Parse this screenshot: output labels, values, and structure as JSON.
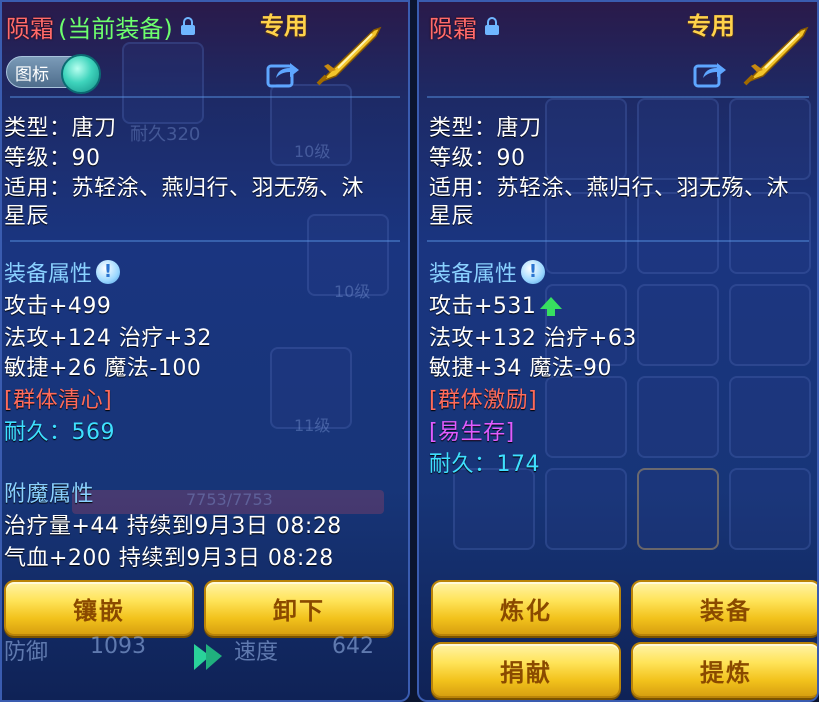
{
  "left": {
    "name": "陨霜",
    "suffix": "(当前装备)",
    "exclusive": "专用",
    "badge_label": "图标",
    "type": "类型：唐刀",
    "level": "等级：90",
    "applies_1": "适用：苏轻涂、燕归行、羽无殇、沐",
    "applies_2": "星辰",
    "section_attr": "装备属性",
    "attack": "攻击+499",
    "line2": "法攻+124 治疗+32",
    "line3": "敏捷+26 魔法-100",
    "skill": "[群体清心]",
    "durability": "耐久：569",
    "section_enchant": "附魔属性",
    "enchant_1": "治疗量+44 持续到9月3日 08:28",
    "enchant_2": "气血+200 持续到9月3日 08:28",
    "buttons": [
      "镶嵌",
      "卸下"
    ]
  },
  "right": {
    "name": "陨霜",
    "exclusive": "专用",
    "type": "类型：唐刀",
    "level": "等级：90",
    "applies_1": "适用：苏轻涂、燕归行、羽无殇、沐",
    "applies_2": "星辰",
    "section_attr": "装备属性",
    "attack": "攻击+531",
    "line2": "法攻+132 治疗+63",
    "line3": "敏捷+34 魔法-90",
    "skill_1": "[群体激励]",
    "skill_2": "[易生存]",
    "durability": "耐久：174",
    "buttons": [
      "炼化",
      "装备",
      "捐献",
      "提炼"
    ]
  },
  "background": {
    "durability_label": "耐久320",
    "level_tag_1": "10级",
    "level_tag_2": "10级",
    "level_tag_3": "11级",
    "hp_bar": "7753/7753",
    "defense_label": "防御",
    "defense_value": "1093",
    "speed_label": "速度",
    "speed_value": "642"
  },
  "colors": {
    "name": "#ff6a6a",
    "current_equip": "#6dff6d",
    "exclusive": "#ffd24a",
    "section_label": "#8ad1ff",
    "durability": "#3fe0ff",
    "skill_red": "#ff6b5b",
    "skill_purple": "#e05cff",
    "button": "#f2c21c"
  },
  "icons": {
    "lock": "lock-icon",
    "share": "share-icon",
    "weapon": "golden-blade-icon",
    "info": "info-icon",
    "upgrade": "green-up-arrow-icon"
  }
}
